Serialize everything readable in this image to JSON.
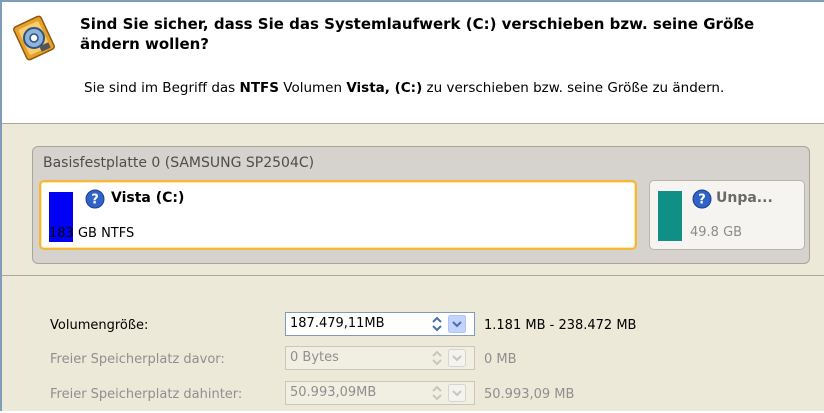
{
  "header": {
    "title": "Sind Sie sicher, dass Sie das Systemlaufwerk (C:) verschieben bzw. seine Größe ändern wollen?",
    "subtitle_parts": [
      "Sie sind im Begriff das ",
      "NTFS",
      " Volumen ",
      "Vista, (C:)",
      " zu verschieben bzw. seine Größe zu ändern."
    ]
  },
  "disk": {
    "title": "Basisfestplatte 0 (SAMSUNG SP2504C)",
    "partitions": [
      {
        "name": "Vista (C:)",
        "size": "183 GB NTFS",
        "color": "#0000f5",
        "selected": true
      },
      {
        "name": "Unpa...",
        "size": "49.8 GB",
        "color": "#108f86",
        "selected": false
      }
    ]
  },
  "fields": {
    "volume_size": {
      "label": "Volumengröße:",
      "value": "187.479,11MB",
      "range": "1.181 MB - 238.472 MB",
      "enabled": true
    },
    "free_before": {
      "label": "Freier Speicherplatz davor:",
      "value": "0 Bytes",
      "range": "0 MB",
      "enabled": false
    },
    "free_after": {
      "label": "Freier Speicherplatz dahinter:",
      "value": "50.993,09MB",
      "range": "50.993,09 MB",
      "enabled": false
    }
  },
  "icons": {
    "header": "disk-wizard-icon",
    "help": "help-icon",
    "spin": "spin-updown-icon",
    "dropdown": "chevron-down-icon"
  },
  "colors": {
    "selection_border": "#f5b73b",
    "help_blue": "#2f63c9",
    "dialog_bg": "#ece9d8"
  }
}
